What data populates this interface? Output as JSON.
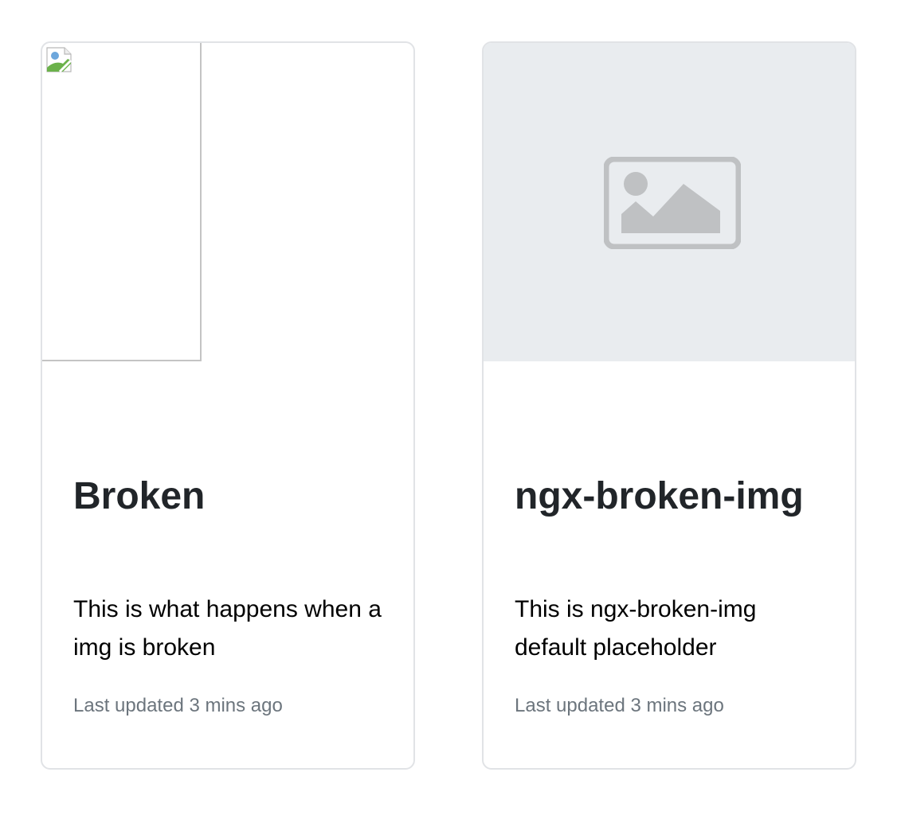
{
  "cards": [
    {
      "title": "Broken",
      "text": "This is what happens when a img is broken",
      "updated": "Last updated 3 mins ago",
      "image": "broken-image-icon"
    },
    {
      "title": "ngx-broken-img",
      "text": "This is ngx-broken-img default placeholder",
      "updated": "Last updated 3 mins ago",
      "image": "image-placeholder-icon"
    }
  ],
  "colors": {
    "title": "#212529",
    "muted": "#6c757d",
    "placeholder_bg": "#e9ecef",
    "placeholder_icon": "#bfc1c3",
    "border": "#e1e3e6"
  }
}
